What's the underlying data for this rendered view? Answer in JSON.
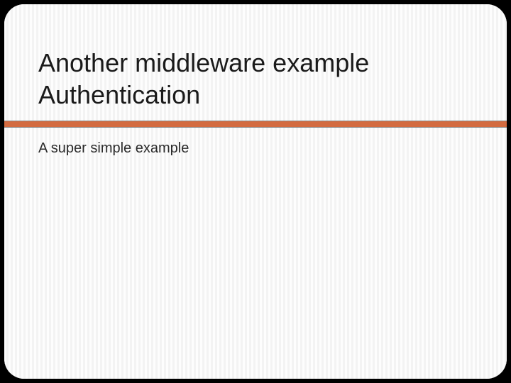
{
  "slide": {
    "title_line1": "Another middleware example",
    "title_line2": "Authentication",
    "subtitle": "A super simple example"
  }
}
